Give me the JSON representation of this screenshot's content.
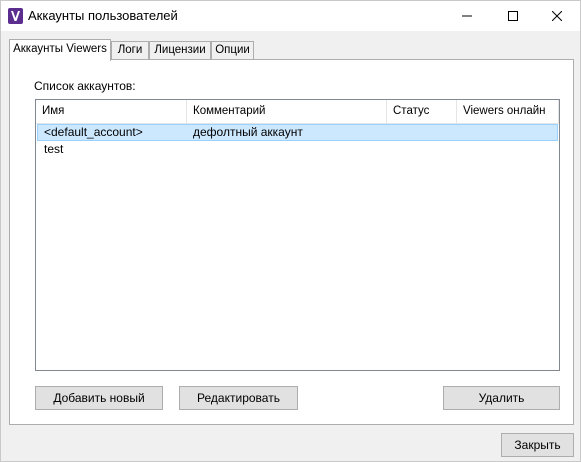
{
  "window": {
    "title": "Аккаунты пользователей",
    "icon": "viewer-app-icon",
    "controls": {
      "minimize_icon": "minimize-icon",
      "maximize_icon": "maximize-icon",
      "close_icon": "close-icon"
    }
  },
  "tabs": [
    {
      "label": "Аккаунты Viewers",
      "active": true
    },
    {
      "label": "Логи",
      "active": false
    },
    {
      "label": "Лицензии",
      "active": false
    },
    {
      "label": "Опции",
      "active": false
    }
  ],
  "accounts_panel": {
    "list_caption": "Список аккаунтов:",
    "columns": [
      "Имя",
      "Комментарий",
      "Статус",
      "Viewers онлайн"
    ],
    "rows": [
      {
        "name": "<default_account>",
        "comment": "дефолтный аккаунт",
        "status": "",
        "online": "",
        "selected": true
      },
      {
        "name": "test",
        "comment": "",
        "status": "",
        "online": "",
        "selected": false
      }
    ],
    "buttons": {
      "add": "Добавить новый",
      "edit": "Редактировать",
      "delete": "Удалить"
    }
  },
  "footer": {
    "close_label": "Закрыть"
  },
  "colors": {
    "selection_bg": "#cce8ff",
    "selection_border": "#99d1ff",
    "app_icon": "#5b2d8f"
  }
}
